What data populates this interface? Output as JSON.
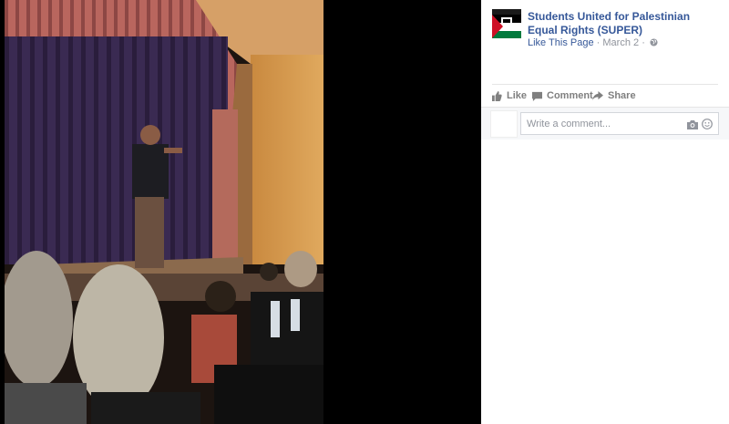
{
  "post": {
    "page_name": "Students United for Palestinian Equal Rights (SUPER)",
    "like_page": "Like This Page",
    "separator": "·",
    "date": "March 2",
    "privacy_icon": "globe-icon"
  },
  "actions": {
    "like": "Like",
    "comment": "Comment",
    "share": "Share"
  },
  "comment_box": {
    "placeholder": "Write a comment..."
  },
  "icons": {
    "like": "thumbs-up-icon",
    "comment": "speech-bubble-icon",
    "share": "share-arrow-icon",
    "camera": "camera-icon",
    "emoji": "smiley-icon"
  },
  "colors": {
    "link": "#365899",
    "meta": "#90949c",
    "action": "#7f7f7f",
    "viewer_bg": "#000000"
  }
}
